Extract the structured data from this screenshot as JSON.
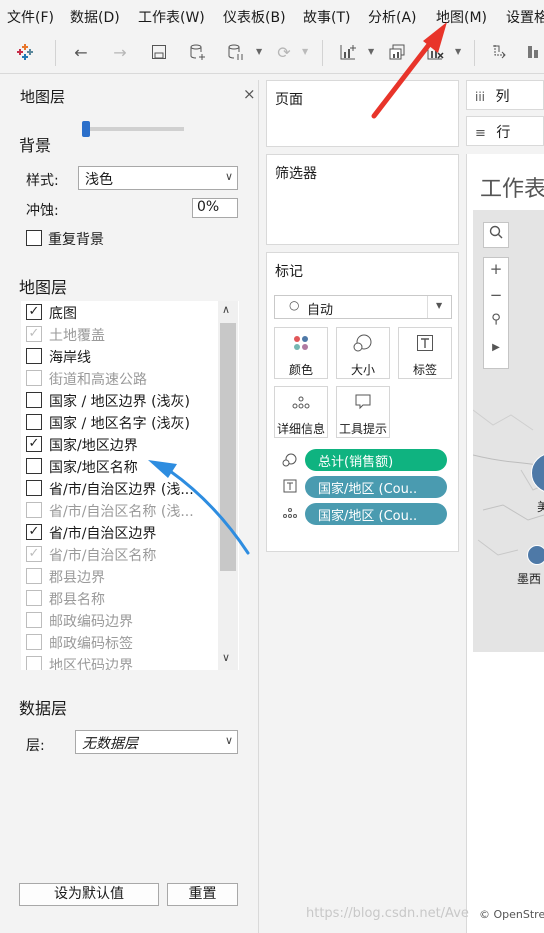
{
  "menubar": {
    "items": [
      "文件(F)",
      "数据(D)",
      "工作表(W)",
      "仪表板(B)",
      "故事(T)",
      "分析(A)",
      "地图(M)",
      "设置格"
    ]
  },
  "map_layers_panel": {
    "title": "地图层",
    "close_glyph": "×",
    "background": {
      "heading": "背景",
      "style_label": "样式:",
      "style_value": "浅色",
      "washout_label": "冲蚀:",
      "washout_value": "0%",
      "repeat_background_label": "重复背景",
      "repeat_background_checked": false
    },
    "layers": {
      "heading": "地图层",
      "items": [
        {
          "label": "底图",
          "checked": true,
          "enabled": true
        },
        {
          "label": "土地覆盖",
          "checked": true,
          "enabled": false
        },
        {
          "label": "海岸线",
          "checked": false,
          "enabled": true
        },
        {
          "label": "街道和高速公路",
          "checked": false,
          "enabled": false
        },
        {
          "label": "国家 / 地区边界 (浅灰)",
          "checked": false,
          "enabled": true
        },
        {
          "label": "国家 / 地区名字 (浅灰)",
          "checked": false,
          "enabled": true
        },
        {
          "label": "国家/地区边界",
          "checked": true,
          "enabled": true
        },
        {
          "label": "国家/地区名称",
          "checked": false,
          "enabled": true
        },
        {
          "label": "省/市/自治区边界 (浅...",
          "checked": false,
          "enabled": true
        },
        {
          "label": "省/市/自治区名称 (浅...",
          "checked": false,
          "enabled": false
        },
        {
          "label": "省/市/自治区边界",
          "checked": true,
          "enabled": true
        },
        {
          "label": "省/市/自治区名称",
          "checked": true,
          "enabled": false
        },
        {
          "label": "郡县边界",
          "checked": false,
          "enabled": false
        },
        {
          "label": "郡县名称",
          "checked": false,
          "enabled": false
        },
        {
          "label": "邮政编码边界",
          "checked": false,
          "enabled": false
        },
        {
          "label": "邮政编码标签",
          "checked": false,
          "enabled": false
        },
        {
          "label": "地区代码边界",
          "checked": false,
          "enabled": false
        }
      ]
    },
    "data_layer": {
      "heading": "数据层",
      "layer_label": "层:",
      "layer_value": "无数据层"
    },
    "set_default_button": "设为默认值",
    "reset_button": "重置"
  },
  "pages_card": {
    "title": "页面"
  },
  "filters_card": {
    "title": "筛选器"
  },
  "marks_card": {
    "title": "标记",
    "mark_type": "自动",
    "buttons": [
      {
        "label": "颜色",
        "icon": "color-dots-icon"
      },
      {
        "label": "大小",
        "icon": "size-circles-icon"
      },
      {
        "label": "标签",
        "icon": "label-T-icon"
      },
      {
        "label": "详细信息",
        "icon": "detail-dots-icon"
      },
      {
        "label": "工具提示",
        "icon": "tooltip-icon"
      }
    ],
    "pills": [
      {
        "label": "总计(销售额)",
        "icon": "size-icon",
        "color": "#0fb380"
      },
      {
        "label": "国家/地区 (Cou..",
        "icon": "label-icon",
        "color": "#4a9bb0"
      },
      {
        "label": "国家/地区 (Cou..",
        "icon": "detail-icon",
        "color": "#4a9bb0"
      }
    ]
  },
  "shelves": {
    "columns_label": "列",
    "rows_label": "行"
  },
  "sheet": {
    "title_visible": "工作表",
    "map_labels": [
      "美",
      "墨西"
    ],
    "credit": "© OpenStre"
  },
  "watermark": "https://blog.csdn.net/Ave",
  "colors": {
    "accent_blue": "#2b6fca",
    "pill_green": "#0fb380",
    "pill_teal": "#4a9bb0",
    "bubble": "#4e79a7",
    "arrow_red": "#e8342a",
    "arrow_blue": "#2e8de0"
  }
}
